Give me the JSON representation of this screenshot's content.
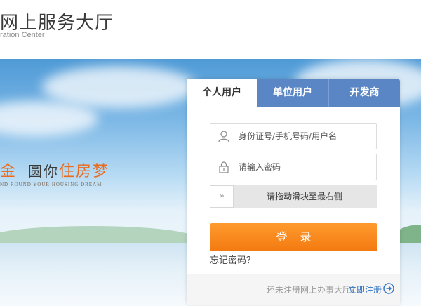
{
  "header": {
    "title": "网上服务大厅",
    "subtitle": "ration Center"
  },
  "banner": {
    "slogan_part1": "金",
    "slogan_part2": "圆你",
    "slogan_part3": "住房梦",
    "slogan_en": "ND ROUND YOUR HOUSING DREAM"
  },
  "login": {
    "tabs": [
      {
        "label": "个人用户",
        "active": true
      },
      {
        "label": "单位用户",
        "active": false
      },
      {
        "label": "开发商",
        "active": false
      }
    ],
    "username_placeholder": "身份证号/手机号码/用户名",
    "password_placeholder": "请输入密码",
    "slider_handle": "»",
    "slider_text": "请拖动滑块至最右侧",
    "login_button": "登录",
    "forgot_link": "忘记密码？",
    "footer_text": "还未注册网上办事大厅？",
    "register_link": "立即注册"
  },
  "colors": {
    "accent_orange": "#f37a10",
    "tab_blue": "#5a86c6",
    "link_blue": "#2f73c5"
  }
}
